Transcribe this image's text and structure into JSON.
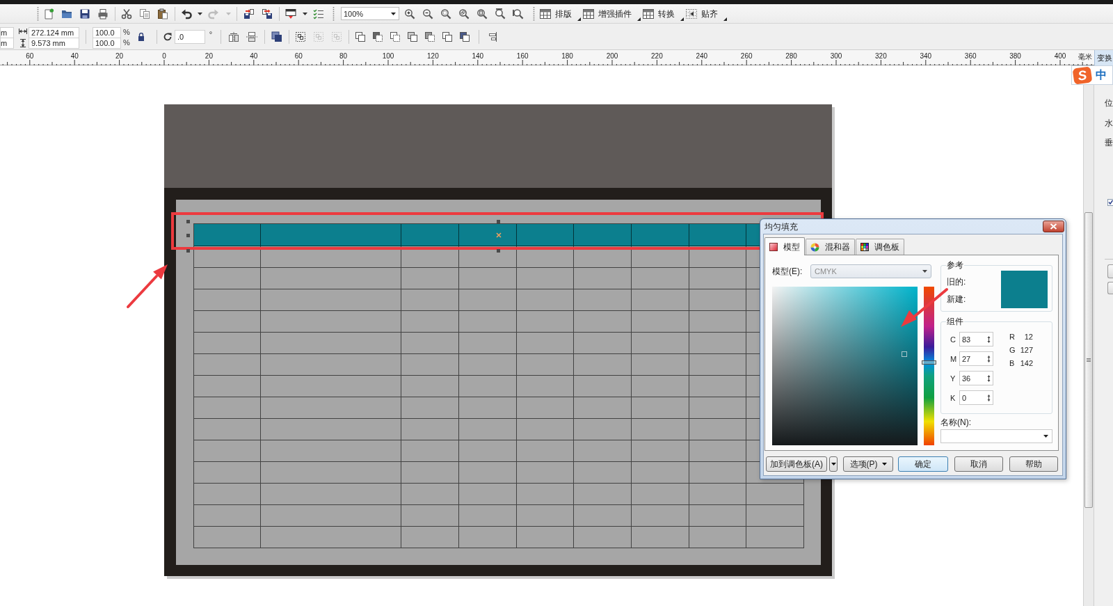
{
  "toolbar": {
    "history_buttons": [
      {
        "disabled": false
      },
      {
        "disabled": true
      }
    ],
    "zoom_level": "100%",
    "menu_buttons": [
      {
        "label": "排版"
      },
      {
        "label": "增强插件"
      },
      {
        "label": "转换"
      },
      {
        "label": "贴齐"
      }
    ]
  },
  "property_bar": {
    "position_fields": [
      "m",
      "m"
    ],
    "size_fields": [
      "272.124 mm",
      "9.573 mm"
    ],
    "scale_fields": [
      "100.0",
      "100.0"
    ],
    "scale_units": [
      "%",
      "%"
    ],
    "rotation": {
      "value": ".0",
      "unit": "°"
    },
    "group_buttons": [
      {
        "disabled": false
      },
      {
        "disabled": true
      },
      {
        "disabled": true
      }
    ]
  },
  "ruler": {
    "labels": [
      "60",
      "40",
      "20",
      "0",
      "20",
      "40",
      "60",
      "80",
      "100",
      "120",
      "140",
      "160",
      "180",
      "200",
      "220",
      "240",
      "260",
      "280",
      "300",
      "320",
      "340",
      "360",
      "380",
      "400"
    ],
    "unit": "毫米"
  },
  "docker": {
    "tab": "变换",
    "labels": [
      "位",
      "水",
      "垂"
    ],
    "checkbox": {
      "checked": true
    }
  },
  "ime": {
    "logo": "S",
    "mode": "中"
  },
  "canvas_table": {
    "rows": [
      {
        "kind": "header",
        "selected": true
      },
      {
        "kind": "body",
        "selected": false
      },
      {
        "kind": "body",
        "selected": false
      },
      {
        "kind": "body",
        "selected": false
      },
      {
        "kind": "body",
        "selected": false
      },
      {
        "kind": "body",
        "selected": false
      },
      {
        "kind": "body",
        "selected": false
      },
      {
        "kind": "body",
        "selected": false
      },
      {
        "kind": "body",
        "selected": false
      },
      {
        "kind": "body",
        "selected": false
      },
      {
        "kind": "body",
        "selected": false
      },
      {
        "kind": "body",
        "selected": false
      },
      {
        "kind": "body",
        "selected": false
      },
      {
        "kind": "body",
        "selected": false
      },
      {
        "kind": "body",
        "selected": false
      }
    ]
  },
  "dialog": {
    "title": "均匀填充",
    "tabs": [
      {
        "label": "模型",
        "selected": true
      },
      {
        "label": "混和器",
        "selected": false
      },
      {
        "label": "调色板",
        "selected": false
      }
    ],
    "model": {
      "label": "模型(E):",
      "value": "CMYK",
      "disabled": true
    },
    "hue_slider": {
      "level": 0.52
    },
    "reference": {
      "title": "参考",
      "labels": [
        "旧的:",
        "新建:"
      ]
    },
    "components": {
      "title": "组件",
      "cmyk": [
        {
          "label": "C",
          "value": "83"
        },
        {
          "label": "M",
          "value": "27"
        },
        {
          "label": "Y",
          "value": "36"
        },
        {
          "label": "K",
          "value": "0"
        }
      ],
      "rgb": [
        {
          "label": "R",
          "value": "12"
        },
        {
          "label": "G",
          "value": "127"
        },
        {
          "label": "B",
          "value": "142"
        }
      ]
    },
    "name_field": {
      "label": "名称(N):"
    },
    "buttons": [
      {
        "label": "加到调色板(A)",
        "kind": "split"
      },
      {
        "label": "选项(P)",
        "kind": "menu"
      },
      {
        "label": "确定",
        "kind": "default"
      },
      {
        "label": "取消",
        "kind": "plain"
      },
      {
        "label": "帮助",
        "kind": "plain"
      }
    ]
  }
}
